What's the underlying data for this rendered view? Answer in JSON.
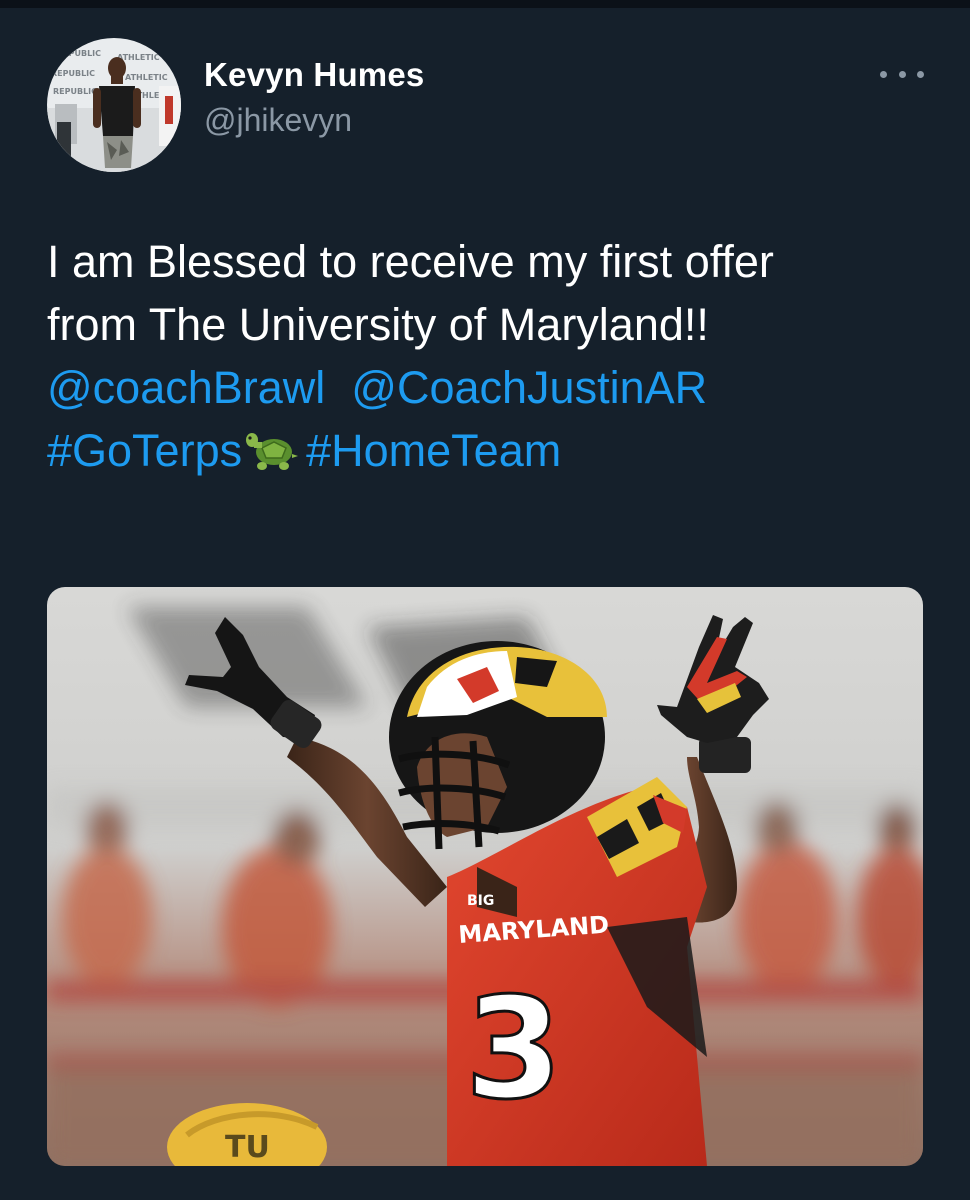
{
  "tweet": {
    "author": {
      "display_name": "Kevyn Humes",
      "handle": "@jhikevyn",
      "avatar_icon": "profile-photo",
      "avatar_backdrop_text": [
        "REPUBLIC",
        "ATHLETIC",
        "REPUBLIC",
        "ATHLETIC",
        "REPUBLIC",
        "ATHLETIC"
      ]
    },
    "more_icon": "more-horizontal-icon",
    "text": {
      "line1": "I am Blessed to receive my first offer",
      "line2": "from The University of Maryland!!",
      "mention1": "@coachBrawl",
      "mention2": "@CoachJustinAR",
      "hashtag1": "#GoTerps",
      "emoji": "turtle-emoji",
      "hashtag2": "#HomeTeam"
    },
    "media": {
      "description_icon": "football-photo",
      "jersey_text": "MARYLAND",
      "jersey_number": "3",
      "conference_text": "BIG",
      "opponent_helmet_text": "TU"
    }
  },
  "colors": {
    "background": "#15202b",
    "text_primary": "#ffffff",
    "text_secondary": "#8b98a5",
    "link": "#1d9bf0"
  }
}
